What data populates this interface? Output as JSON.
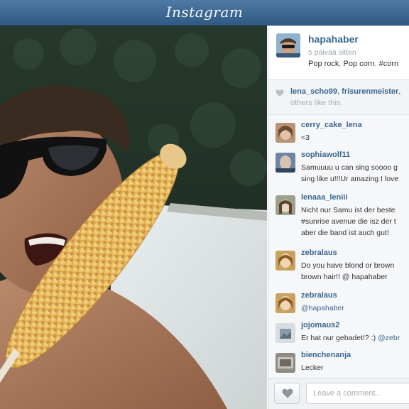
{
  "app": {
    "title": "Instagram"
  },
  "post": {
    "username": "hapahaber",
    "time_ago": "5 päivää sitten",
    "caption": "Pop rock. Pop corn. #corn"
  },
  "likes": {
    "names": [
      "lena_scho99",
      "frisurenmeister"
    ],
    "rest_text": "others like this."
  },
  "comments": [
    {
      "user": "cerry_cake_lena",
      "lines": [
        "<3"
      ]
    },
    {
      "user": "sophiawolf11",
      "lines": [
        "Samuuuu u can sing soooo g",
        "sing like u!!!Ur amazing I love"
      ]
    },
    {
      "user": "lenaaa_leniii",
      "lines": [
        "Nicht nur Samu ist der beste",
        "#sunrise avenue die isz der t",
        "aber die band ist auch gut!"
      ]
    },
    {
      "user": "zebralaus",
      "lines": [
        "Do you have blond or brown",
        "brown hair!! @ hapahaber"
      ]
    },
    {
      "user": "zebralaus",
      "lines": [
        "@hapahaber"
      ],
      "mention": true
    },
    {
      "user": "jojomaus2",
      "lines": [
        "Er hat nur gebadet!? :) "
      ],
      "tail_mention": "@zebr"
    },
    {
      "user": "bienchenanja",
      "lines": [
        "Lecker"
      ]
    }
  ],
  "composer": {
    "placeholder": "Leave a comment..."
  },
  "icons": {
    "heart": "heart-icon",
    "like_button": "heart-icon"
  },
  "colors": {
    "brand_bar": "#3c6891",
    "username": "#3a6790",
    "muted": "#9aa3ad"
  }
}
